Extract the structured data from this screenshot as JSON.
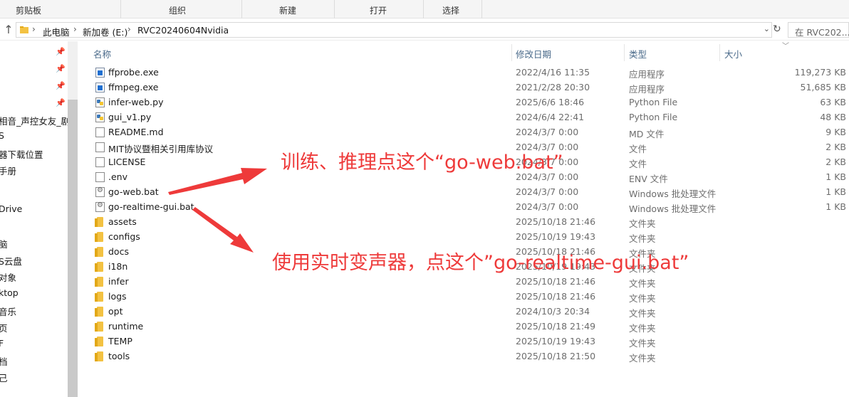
{
  "ribbon": {
    "groups": [
      "剪贴板",
      "组织",
      "新建",
      "打开",
      "选择"
    ]
  },
  "address": {
    "crumbs": [
      "此电脑",
      "新加卷 (E:)",
      "RVC20240604Nvidia"
    ],
    "search_placeholder": "在 RVC202..."
  },
  "nav": {
    "items": [
      "",
      "",
      "",
      "",
      "相音_声控女友_剧情",
      "S",
      "器下载位置",
      "手册",
      "",
      "Drive",
      "",
      "脑",
      "S云盘",
      "对象",
      "ktop",
      "音乐",
      "页",
      "F",
      "档",
      "己"
    ]
  },
  "columns": {
    "name": "名称",
    "date": "修改日期",
    "type": "类型",
    "size": "大小"
  },
  "files": [
    {
      "name": "ffprobe.exe",
      "date": "2022/4/16 11:35",
      "type": "应用程序",
      "size": "119,273 KB",
      "icon": "exe-icon"
    },
    {
      "name": "ffmpeg.exe",
      "date": "2021/2/28 20:30",
      "type": "应用程序",
      "size": "51,685 KB",
      "icon": "exe-icon"
    },
    {
      "name": "infer-web.py",
      "date": "2025/6/6 18:46",
      "type": "Python File",
      "size": "63 KB",
      "icon": "python-file-icon"
    },
    {
      "name": "gui_v1.py",
      "date": "2024/6/4 22:41",
      "type": "Python File",
      "size": "48 KB",
      "icon": "python-file-icon"
    },
    {
      "name": "README.md",
      "date": "2024/3/7 0:00",
      "type": "MD 文件",
      "size": "9 KB",
      "icon": "document-icon"
    },
    {
      "name": "MIT协议暨相关引用库协议",
      "date": "2024/3/7 0:00",
      "type": "文件",
      "size": "2 KB",
      "icon": "document-icon"
    },
    {
      "name": "LICENSE",
      "date": "2024/3/7 0:00",
      "type": "文件",
      "size": "2 KB",
      "icon": "document-icon"
    },
    {
      "name": ".env",
      "date": "2024/3/7 0:00",
      "type": "ENV 文件",
      "size": "1 KB",
      "icon": "document-icon"
    },
    {
      "name": "go-web.bat",
      "date": "2024/3/7 0:00",
      "type": "Windows 批处理文件",
      "size": "1 KB",
      "icon": "batch-file-icon"
    },
    {
      "name": "go-realtime-gui.bat",
      "date": "2024/3/7 0:00",
      "type": "Windows 批处理文件",
      "size": "1 KB",
      "icon": "batch-file-icon"
    },
    {
      "name": "assets",
      "date": "2025/10/18 21:46",
      "type": "文件夹",
      "size": "",
      "icon": "folder-icon"
    },
    {
      "name": "configs",
      "date": "2025/10/19 19:43",
      "type": "文件夹",
      "size": "",
      "icon": "folder-icon"
    },
    {
      "name": "docs",
      "date": "2025/10/18 21:46",
      "type": "文件夹",
      "size": "",
      "icon": "folder-icon"
    },
    {
      "name": "i18n",
      "date": "2025/10/19 19:43",
      "type": "文件夹",
      "size": "",
      "icon": "folder-icon"
    },
    {
      "name": "infer",
      "date": "2025/10/18 21:46",
      "type": "文件夹",
      "size": "",
      "icon": "folder-icon"
    },
    {
      "name": "logs",
      "date": "2025/10/18 21:46",
      "type": "文件夹",
      "size": "",
      "icon": "folder-icon"
    },
    {
      "name": "opt",
      "date": "2024/10/3 20:34",
      "type": "文件夹",
      "size": "",
      "icon": "folder-icon"
    },
    {
      "name": "runtime",
      "date": "2025/10/18 21:49",
      "type": "文件夹",
      "size": "",
      "icon": "folder-icon"
    },
    {
      "name": "TEMP",
      "date": "2025/10/19 19:43",
      "type": "文件夹",
      "size": "",
      "icon": "folder-icon"
    },
    {
      "name": "tools",
      "date": "2025/10/18 21:50",
      "type": "文件夹",
      "size": "",
      "icon": "folder-icon"
    }
  ],
  "annotations": {
    "train": "训练、推理点这个“go-web.bat”",
    "realtime": "使用实时变声器，点这个”go-realtime-gui.bat”",
    "color": "#ee3a3a"
  }
}
